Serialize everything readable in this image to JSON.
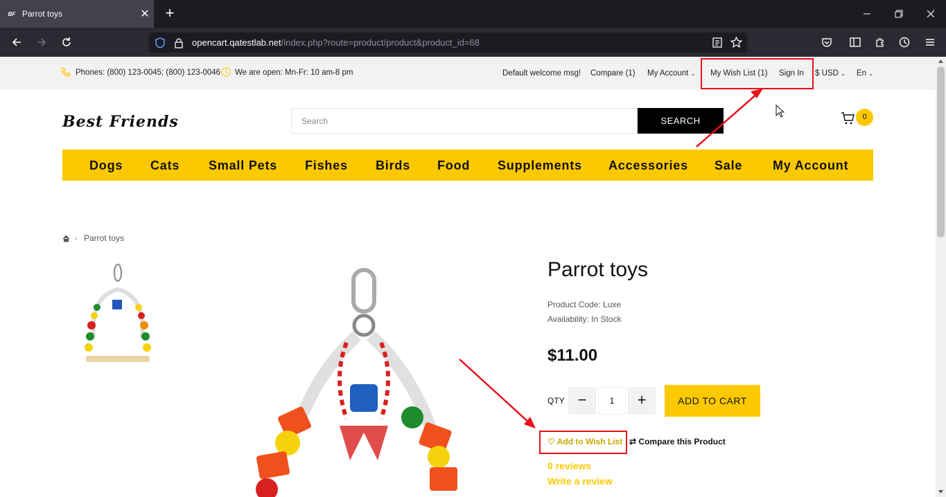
{
  "browser": {
    "tab_title": "Parrot toys",
    "favicon_text": "BF",
    "url_domain": "opencart.qatestlab.net",
    "url_path": "/index.php?route=product/product&product_id=68"
  },
  "topbar": {
    "phones": "Phones: (800) 123-0045; (800) 123-0046",
    "hours": "We are open: Mn-Fr: 10 am-8 pm",
    "welcome": "Default welcome msg!",
    "compare": "Compare (1)",
    "my_account": "My Account",
    "wishlist": "My Wish List (1)",
    "sign_in": "Sign In",
    "currency": "$ USD",
    "language": "En"
  },
  "header": {
    "logo": "Best Friends",
    "search_placeholder": "Search",
    "search_button": "SEARCH",
    "cart_count": "0"
  },
  "menu": [
    "Dogs",
    "Cats",
    "Small Pets",
    "Fishes",
    "Birds",
    "Food",
    "Supplements",
    "Accessories",
    "Sale",
    "My Account"
  ],
  "breadcrumb": {
    "current": "Parrot toys"
  },
  "product": {
    "title": "Parrot toys",
    "code": "Product Code: Luxe",
    "availability": "Availability: In Stock",
    "price": "$11.00",
    "qty_label": "QTY",
    "qty": "1",
    "add_to_cart": "ADD TO CART",
    "add_to_wishlist": "Add to Wish List",
    "compare": "Compare this Product",
    "reviews": "0 reviews",
    "write_review": "Write a review"
  },
  "colors": {
    "accent": "#fcc800",
    "annotation": "#e8101a"
  }
}
